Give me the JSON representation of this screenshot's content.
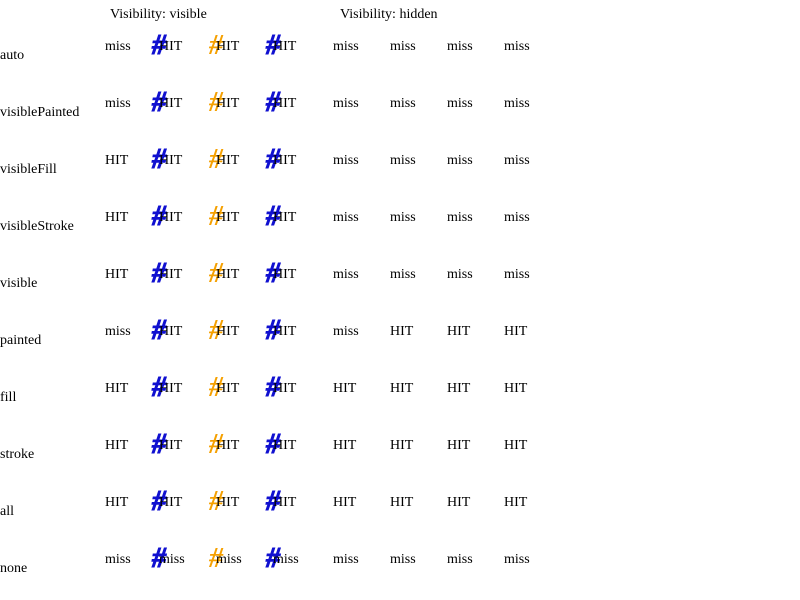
{
  "headers": {
    "visible": "Visibility: visible",
    "hidden": "Visibility: hidden"
  },
  "colors": {
    "blue_mark": "#1010d0",
    "orange_mark": "#f5a000"
  },
  "glyph": "#",
  "rows": [
    {
      "label": "auto",
      "cells": [
        "miss",
        "HIT",
        "HIT",
        "HIT",
        "miss",
        "miss",
        "miss",
        "miss"
      ]
    },
    {
      "label": "visiblePainted",
      "cells": [
        "miss",
        "HIT",
        "HIT",
        "HIT",
        "miss",
        "miss",
        "miss",
        "miss"
      ]
    },
    {
      "label": "visibleFill",
      "cells": [
        "HIT",
        "HIT",
        "HIT",
        "HIT",
        "miss",
        "miss",
        "miss",
        "miss"
      ]
    },
    {
      "label": "visibleStroke",
      "cells": [
        "HIT",
        "HIT",
        "HIT",
        "HIT",
        "miss",
        "miss",
        "miss",
        "miss"
      ]
    },
    {
      "label": "visible",
      "cells": [
        "HIT",
        "HIT",
        "HIT",
        "HIT",
        "miss",
        "miss",
        "miss",
        "miss"
      ]
    },
    {
      "label": "painted",
      "cells": [
        "miss",
        "HIT",
        "HIT",
        "HIT",
        "miss",
        "HIT",
        "HIT",
        "HIT"
      ]
    },
    {
      "label": "fill",
      "cells": [
        "HIT",
        "HIT",
        "HIT",
        "HIT",
        "HIT",
        "HIT",
        "HIT",
        "HIT"
      ]
    },
    {
      "label": "stroke",
      "cells": [
        "HIT",
        "HIT",
        "HIT",
        "HIT",
        "HIT",
        "HIT",
        "HIT",
        "HIT"
      ]
    },
    {
      "label": "all",
      "cells": [
        "HIT",
        "HIT",
        "HIT",
        "HIT",
        "HIT",
        "HIT",
        "HIT",
        "HIT"
      ]
    },
    {
      "label": "none",
      "cells": [
        "miss",
        "miss",
        "miss",
        "miss",
        "miss",
        "miss",
        "miss",
        "miss"
      ]
    }
  ]
}
